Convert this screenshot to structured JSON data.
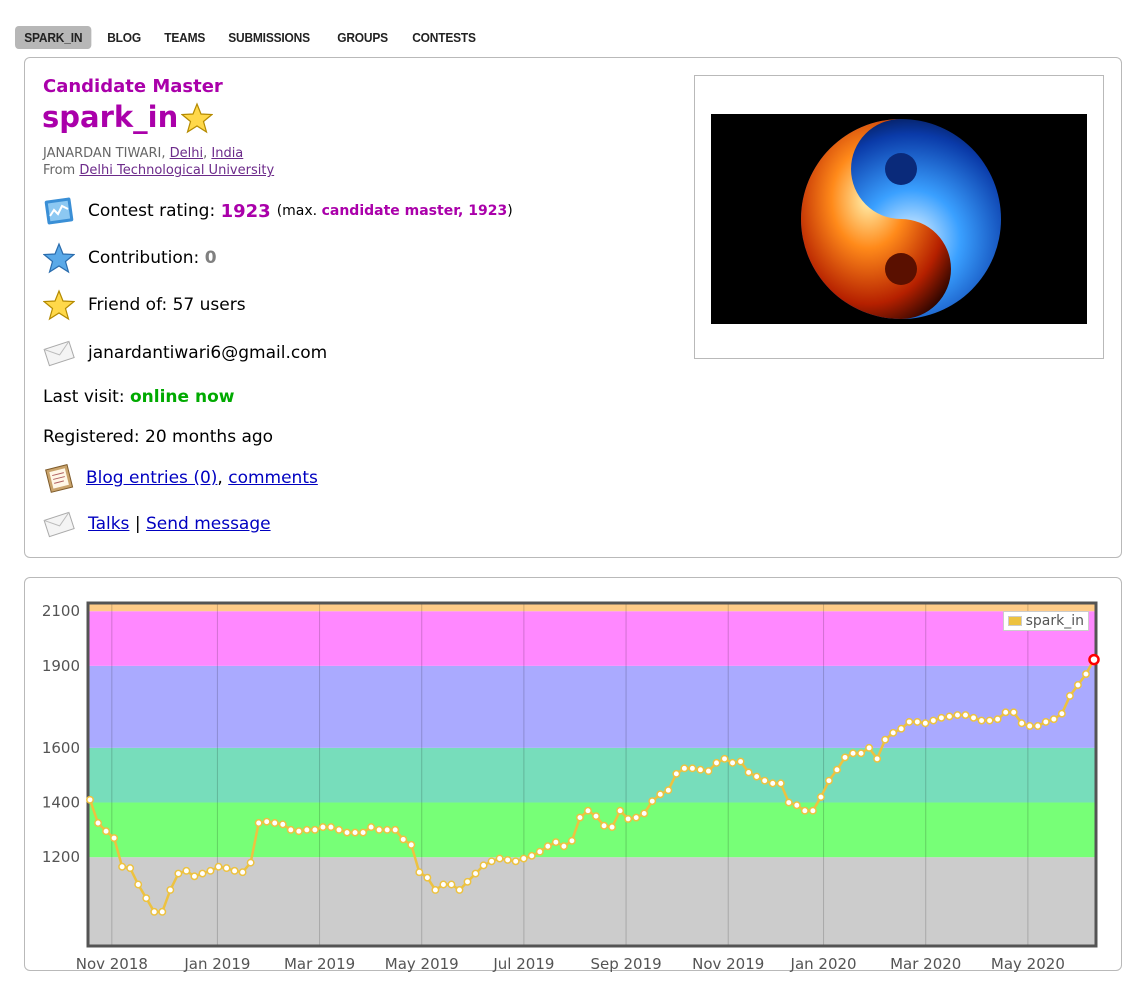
{
  "nav": {
    "tabs": [
      {
        "label": "SPARK_IN",
        "active": true
      },
      {
        "label": "BLOG"
      },
      {
        "label": "TEAMS"
      },
      {
        "label": "SUBMISSIONS"
      },
      {
        "label": "GROUPS"
      },
      {
        "label": "CONTESTS"
      }
    ]
  },
  "profile": {
    "rank": "Candidate Master",
    "handle": "spark_in",
    "name": "JANARDAN TIWARI",
    "city": "Delhi",
    "country": "India",
    "from_prefix": "From",
    "organization": "Delhi Technological University",
    "contest_rating_label": "Contest rating:",
    "contest_rating": "1923",
    "max_prefix": "(max.",
    "max_rank_rating": "candidate master, 1923",
    "max_suffix": ")",
    "contribution_label": "Contribution:",
    "contribution": "0",
    "friend_of": "Friend of: 57 users",
    "email": "janardantiwari6@gmail.com",
    "last_visit_label": "Last visit:",
    "last_visit": "online now",
    "registered": "Registered: 20 months ago",
    "blog_entries": "Blog entries (0)",
    "comments": "comments",
    "talks": "Talks",
    "separator": "|",
    "send_message": "Send message",
    "colors": {
      "rank": "#aa00aa",
      "online": "#00aa00"
    }
  },
  "chart_data": {
    "type": "line",
    "series": [
      {
        "name": "spark_in",
        "color": "#edc240"
      }
    ],
    "x_ticks": [
      "Nov 2018",
      "Jan 2019",
      "Mar 2019",
      "May 2019",
      "Jul 2019",
      "Sep 2019",
      "Nov 2019",
      "Jan 2020",
      "Mar 2020",
      "May 2020"
    ],
    "y_ticks": [
      1200,
      1400,
      1600,
      1900,
      2100
    ],
    "ylim": [
      875,
      2130
    ],
    "bands": [
      {
        "from": 875,
        "to": 1200,
        "color": "#cccccc"
      },
      {
        "from": 1200,
        "to": 1400,
        "color": "#77ff77"
      },
      {
        "from": 1400,
        "to": 1600,
        "color": "#77ddbb"
      },
      {
        "from": 1600,
        "to": 1900,
        "color": "#aaaaff"
      },
      {
        "from": 1900,
        "to": 2100,
        "color": "#ff88ff"
      },
      {
        "from": 2100,
        "to": 2130,
        "color": "#ffcc88"
      }
    ],
    "x": [
      0.0,
      0.3,
      0.45,
      0.6,
      1.1,
      1.2,
      1.3,
      1.45,
      1.8,
      2.0,
      2.05,
      2.55,
      2.75,
      2.85,
      3.0,
      3.05,
      3.2,
      3.35,
      3.6,
      3.75,
      4.2,
      5.05,
      5.1,
      5.5,
      5.55,
      5.6,
      5.65,
      5.7,
      5.85,
      6.0,
      6.2,
      7.1,
      7.75,
      8.3,
      8.4,
      8.5,
      8.65,
      9.25,
      9.35,
      9.6,
      9.75,
      9.85,
      10.0,
      10.05,
      10.15,
      10.25,
      10.4,
      10.55,
      10.7,
      10.85,
      11.0,
      11.15,
      11.3,
      11.45,
      11.6,
      11.8,
      11.9,
      12.2,
      12.3,
      12.45,
      12.55,
      12.75,
      12.8,
      12.95,
      13.1,
      13.4,
      13.5,
      13.65,
      13.8,
      14.0,
      14.1,
      14.2,
      14.35,
      14.5,
      14.7,
      14.8
    ],
    "y": [
      1410,
      1325,
      1295,
      1270,
      1165,
      1160,
      1100,
      1050,
      1000,
      1000,
      1080,
      1140,
      1150,
      1130,
      1140,
      1150,
      1165,
      1160,
      1150,
      1145,
      1180,
      1325,
      1330,
      1325,
      1320,
      1300,
      1295,
      1300,
      1300,
      1310,
      1310,
      1300,
      1290,
      1290,
      1290,
      1310,
      1300,
      1300,
      1300,
      1265,
      1245,
      1145,
      1125,
      1080,
      1100,
      1100,
      1080,
      1110,
      1140,
      1170,
      1185,
      1195,
      1190,
      1185,
      1195,
      1205,
      1220,
      1240,
      1255,
      1240,
      1260,
      1345,
      1370,
      1350,
      1315,
      1310,
      1370,
      1340,
      1345,
      1360,
      1405,
      1430,
      1445,
      1505,
      1525,
      1525,
      1520,
      1515,
      1545,
      1560,
      1545,
      1550,
      1510,
      1495,
      1480,
      1470,
      1470,
      1400,
      1390,
      1370,
      1370,
      1420,
      1480,
      1520,
      1565,
      1580,
      1580,
      1600,
      1560,
      1630,
      1655,
      1670,
      1695,
      1695,
      1690,
      1700,
      1710,
      1715,
      1720,
      1720,
      1710,
      1700,
      1700,
      1705,
      1730,
      1730,
      1690,
      1680,
      1680,
      1695,
      1705,
      1725,
      1790,
      1830,
      1870,
      1923
    ]
  }
}
